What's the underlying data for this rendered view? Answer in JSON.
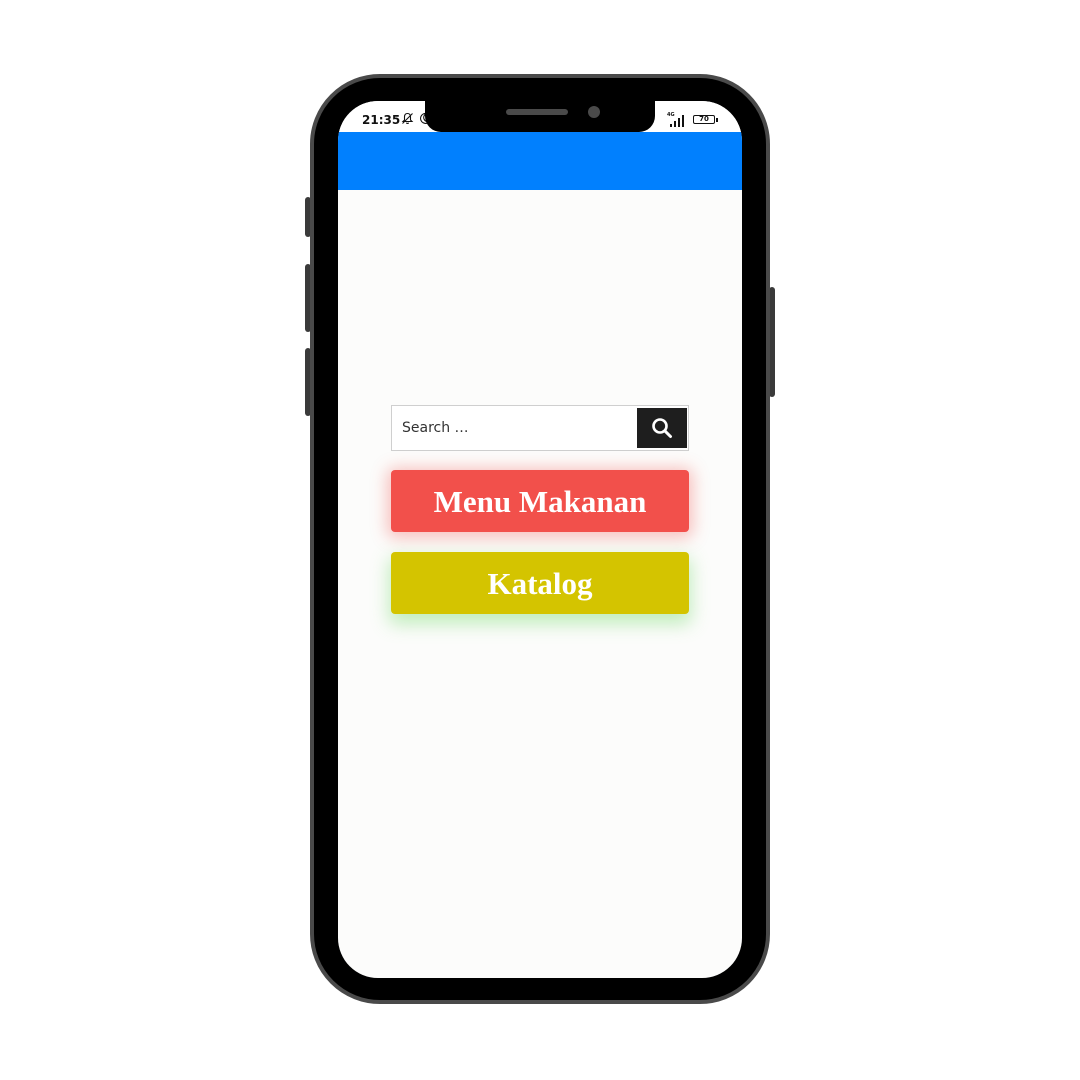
{
  "status_bar": {
    "time": "21:35",
    "network": "4G",
    "battery": "70",
    "icons": [
      "bell-off-icon",
      "moon-icon",
      "signal-icon",
      "battery-icon"
    ]
  },
  "app_bar": {
    "color": "#0180fe"
  },
  "search": {
    "placeholder": "Search …",
    "button_icon": "search-icon"
  },
  "buttons": {
    "menu_makanan": {
      "label": "Menu Makanan",
      "color": "#f2504b"
    },
    "katalog": {
      "label": "Katalog",
      "color": "#d4c400"
    }
  }
}
